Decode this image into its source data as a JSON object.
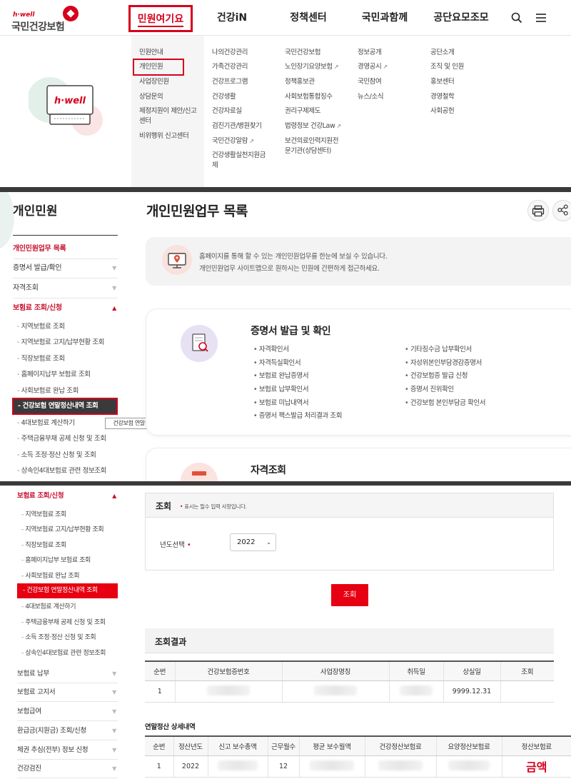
{
  "header": {
    "logo_small": "h·well",
    "logo_text": "국민건강보험",
    "nav": [
      "민원여기요",
      "건강iN",
      "정책센터",
      "국민과함께",
      "공단요모조모"
    ],
    "search_icon": "search-icon",
    "menu_icon": "hamburger-menu-icon"
  },
  "mega_menu": {
    "illustration_label": "h·well",
    "col1": [
      "민원안내",
      "개인민원",
      "사업장민원",
      "상담문의",
      "제정지원이 제안/신고센터",
      "비위행위 신고센터"
    ],
    "col2": [
      "나의건강관리",
      "가족건강관리",
      "건강프로그램",
      "건강생활",
      "건강자료실",
      "검진기관/병원찾기",
      "국민건강알람",
      "건강생활실천지원금제"
    ],
    "col3": [
      "국민건강보험",
      "노인장기요양보험",
      "정책홍보관",
      "사회보험통합징수",
      "권리구제제도",
      "법령정보 건강Law",
      "보건의료인력지원전문기관(상담센터)"
    ],
    "col4": [
      "정보공개",
      "경영공시",
      "국민참여",
      "뉴스/소식"
    ],
    "col5": [
      "공단소개",
      "조직 및 인원",
      "홍보센터",
      "경영철학",
      "사회공헌"
    ]
  },
  "sidebar": {
    "title": "개인민원",
    "items": [
      {
        "label": "개인민원업무 목록"
      },
      {
        "label": "증명서 발급/확인"
      },
      {
        "label": "자격조회"
      },
      {
        "label": "보험료 조회/신청"
      }
    ],
    "sub_items": [
      "지역보험료 조회",
      "지역보험료 고지/납부현황 조회",
      "직장보험료 조회",
      "홈페이지납부 보험료 조회",
      "사회보험료 완납 조회",
      "건강보험 연말정산내역 조회",
      "4대보험료 계산하기",
      "주택금융부채 공제 신청 및 조회",
      "소득 조정·정산 신청 및 조회",
      "상속인4대보험료 관련 정보조회"
    ],
    "tooltip": "건강보험 연말정산내역 조회",
    "more_items": [
      "보험료 납부",
      "보험료 고지서",
      "보험급여",
      "환급금(지원금) 조회/신청",
      "체권 추심(전부) 정보 신청",
      "건강검진"
    ]
  },
  "main": {
    "title": "개인민원업무 목록",
    "print_icon": "print-icon",
    "share_icon": "share-icon",
    "notice_line1": "홈페이지를 통해 할 수 있는 개인민원업무를 한눈에 보실 수 있습니다.",
    "notice_line2": "개인민원업무 사이트맵으로 원하시는 민원에 간편하게 접근하세요.",
    "card1_title": "증명서 발급 및 확인",
    "card1_left": [
      "자격확인서",
      "자격득실확인서",
      "보험료 완납증명서",
      "보험료 납부확인서",
      "보험료 미납내역서",
      "증명서 팩스발급 처리결과 조회"
    ],
    "card1_right": [
      "기타징수금 납부확인서",
      "자성위본인부담경감증명서",
      "건강보험증 발급 신청",
      "증명서 진위확인",
      "건강보험 본인부담금 확인서"
    ],
    "card2_title": "자격조회"
  },
  "search": {
    "title": "조회",
    "required_note": "표시는 필수 입력 사항입니다.",
    "required_mark": "•",
    "year_label": "년도선택",
    "year_value": "2022",
    "button": "조회"
  },
  "result": {
    "title": "조회결과",
    "columns": [
      "순번",
      "건강보험증번호",
      "사업장명칭",
      "취득일",
      "상실일",
      "조회"
    ],
    "rows": [
      [
        "1",
        "",
        "",
        "",
        "9999.12.31",
        ""
      ]
    ]
  },
  "detail": {
    "title": "연말정산 상세내역",
    "columns": [
      "순번",
      "정산년도",
      "신고 보수총액",
      "근무월수",
      "평균 보수월액",
      "건강정산보험료",
      "요양정산보험료",
      "정산보험료"
    ],
    "rows": [
      [
        "1",
        "2022",
        "",
        "12",
        "",
        "",
        "",
        "금액"
      ]
    ]
  },
  "colors": {
    "brand_red": "#d6001c",
    "dark_bar": "#3a3a3a"
  }
}
